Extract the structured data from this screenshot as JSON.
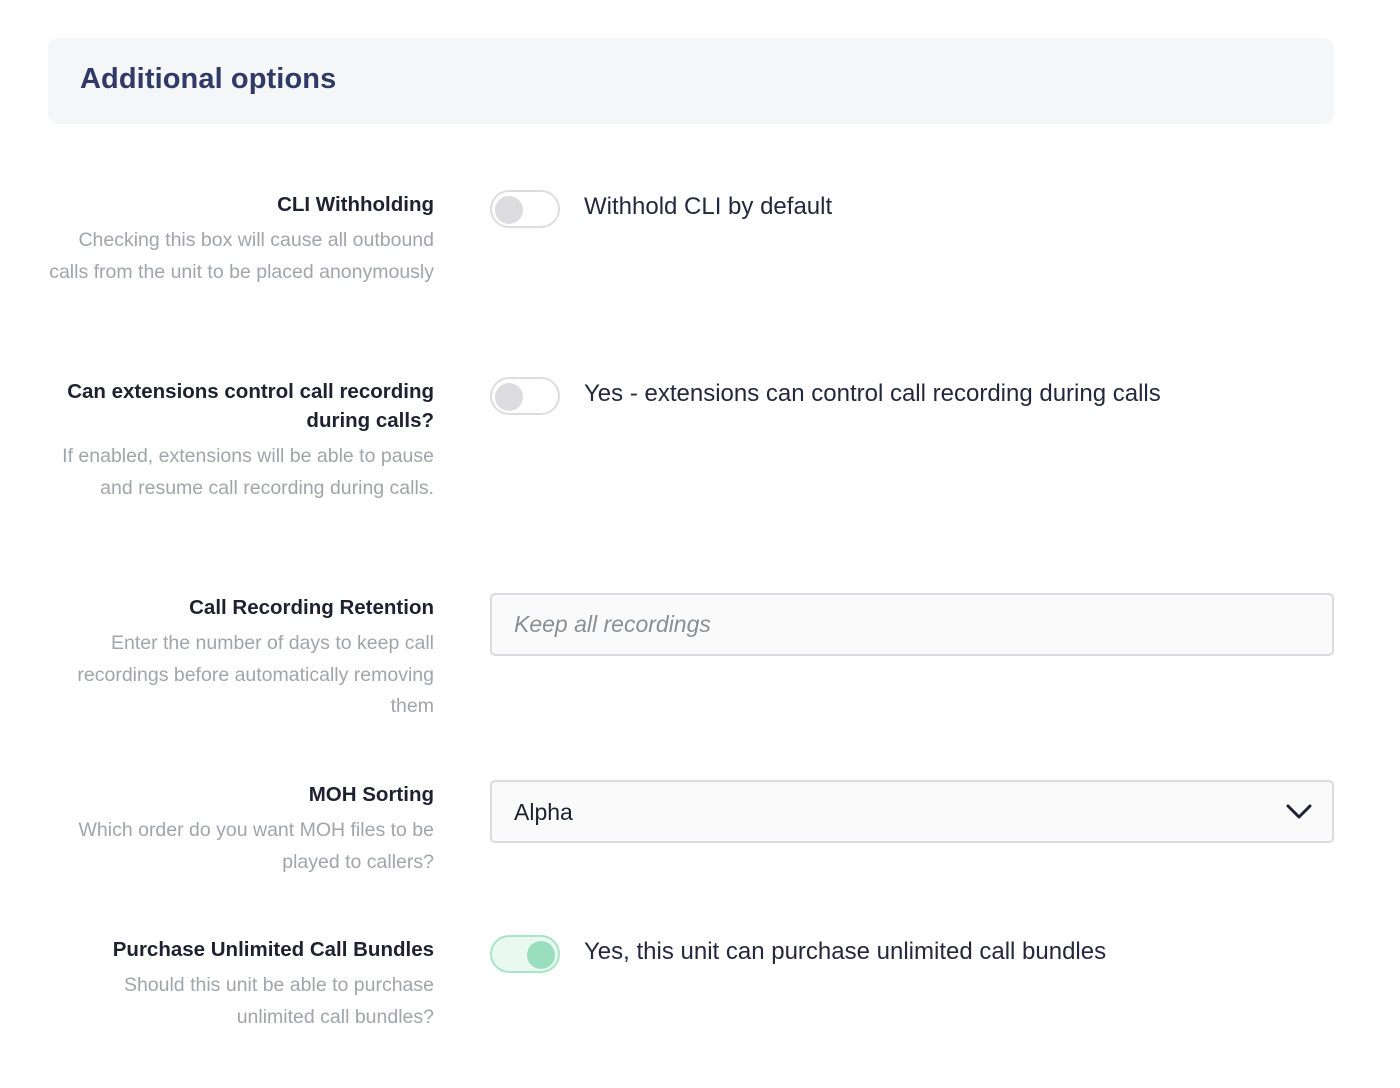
{
  "panel": {
    "title": "Additional options"
  },
  "fields": {
    "cli_withholding": {
      "label": "CLI Withholding",
      "help": "Checking this box will cause all outbound calls from the unit to be placed anonymously",
      "toggle_text": "Withhold CLI by default",
      "enabled": false
    },
    "extension_recording_control": {
      "label": "Can extensions control call recording during calls?",
      "help": "If enabled, extensions will be able to pause and resume call recording during calls.",
      "toggle_text": "Yes - extensions can control call recording during calls",
      "enabled": false
    },
    "call_recording_retention": {
      "label": "Call Recording Retention",
      "help": "Enter the number of days to keep call recordings before automatically removing them",
      "value": "",
      "placeholder": "Keep all recordings"
    },
    "moh_sorting": {
      "label": "MOH Sorting",
      "help": "Which order do you want MOH files to be played to callers?",
      "selected": "Alpha"
    },
    "unlimited_call_bundles": {
      "label": "Purchase Unlimited Call Bundles",
      "help": "Should this unit be able to purchase unlimited call bundles?",
      "toggle_text": "Yes, this unit can purchase unlimited call bundles",
      "enabled": true
    }
  },
  "icons": {
    "select_arrow": "chevron-down-icon"
  },
  "colors": {
    "title": "#2f3a66",
    "toggle_on": "#9adfbd",
    "toggle_off": "#dcdcde",
    "help_text": "#a2a4ab"
  }
}
